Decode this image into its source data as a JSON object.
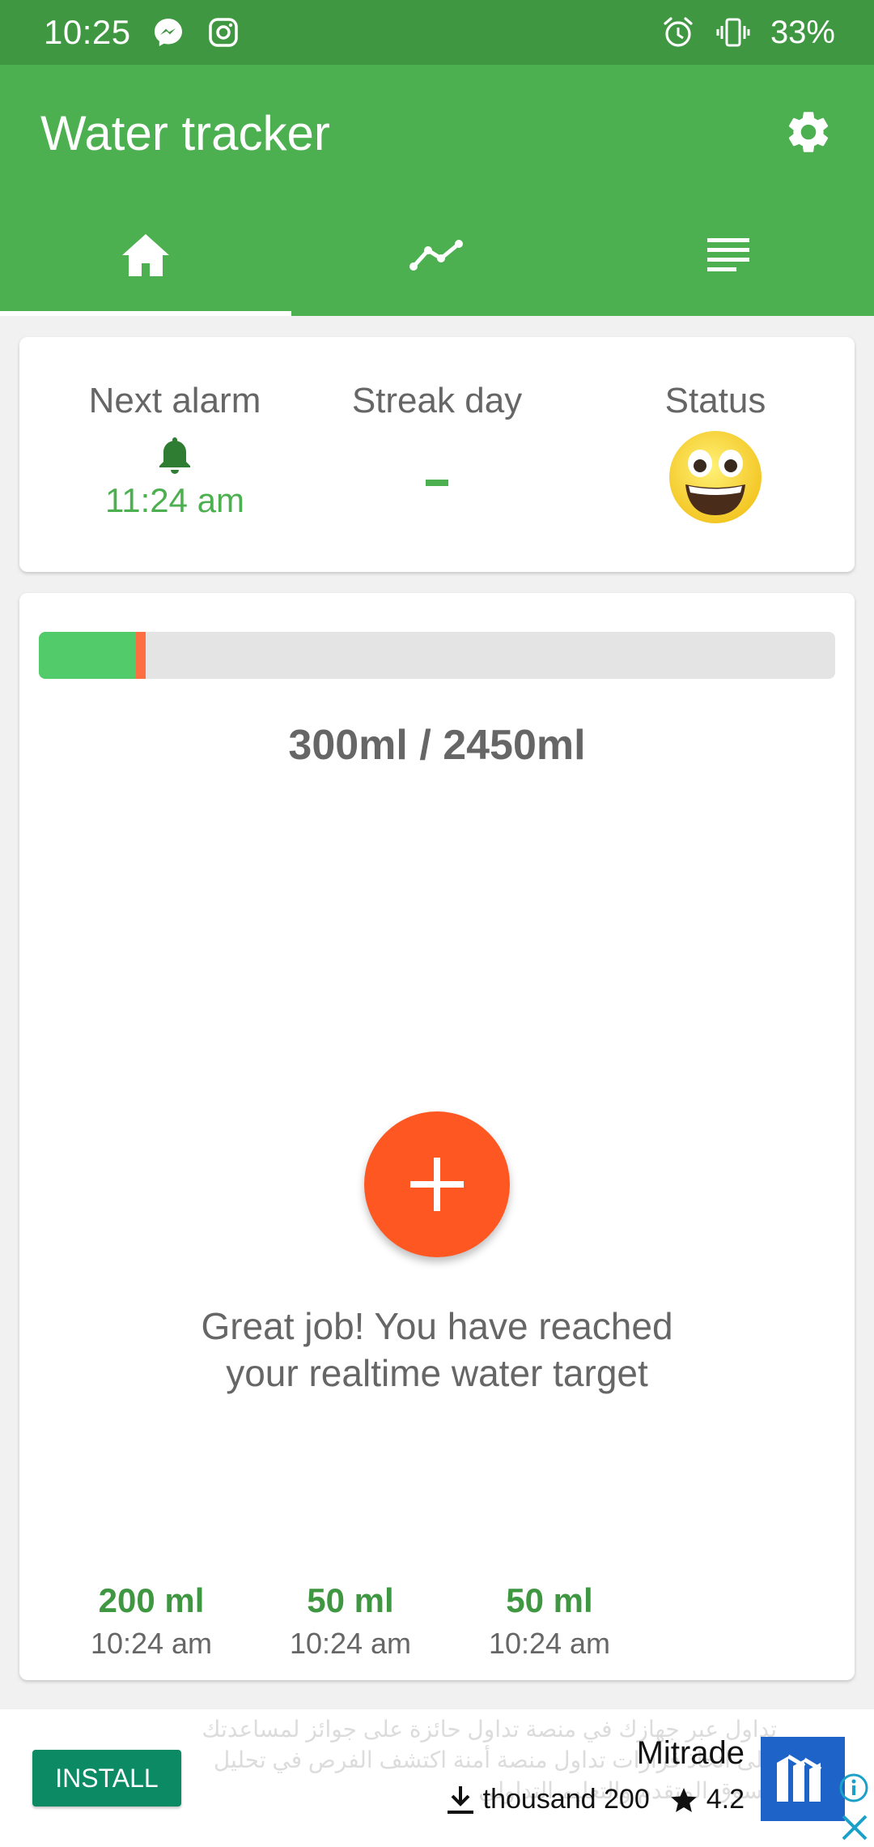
{
  "status_bar": {
    "time": "10:25",
    "battery": "33%",
    "icons": [
      "messenger-icon",
      "instagram-icon",
      "alarm-icon",
      "vibrate-icon"
    ]
  },
  "app_bar": {
    "title": "Water tracker",
    "settings_icon": "gear-icon",
    "tabs": [
      {
        "icon": "home-icon",
        "active": true
      },
      {
        "icon": "chart-line-icon",
        "active": false
      },
      {
        "icon": "list-icon",
        "active": false
      }
    ]
  },
  "info_card": {
    "next_alarm_label": "Next alarm",
    "next_alarm_time": "11:24 am",
    "streak_label": "Streak day",
    "status_label": "Status",
    "status_icon": "smiley-icon"
  },
  "progress": {
    "current": 300,
    "target": 2450,
    "text": "300ml / 2450ml"
  },
  "message": {
    "line1": "Great job! You have reached",
    "line2": "your realtime water target"
  },
  "history": [
    {
      "amount": "200 ml",
      "time": "10:24 am"
    },
    {
      "amount": "50 ml",
      "time": "10:24 am"
    },
    {
      "amount": "50 ml",
      "time": "10:24 am"
    }
  ],
  "ad": {
    "install_label": "INSTALL",
    "app_name": "Mitrade",
    "downloads": "thousand 200",
    "rating": "4.2",
    "background_text": "تداول عبر جهازك في منصة تداول حائزة على جوائز لمساعدتك على اتخاذ قرارات تداول منصة أمنة اكتشف الفرص في تحليل السوق المتقدم والتعليم التداولي"
  },
  "colors": {
    "primary": "#4caf50",
    "primary_dark": "#3f9742",
    "accent": "#ff5722",
    "progress_fill": "#52cc6a"
  }
}
